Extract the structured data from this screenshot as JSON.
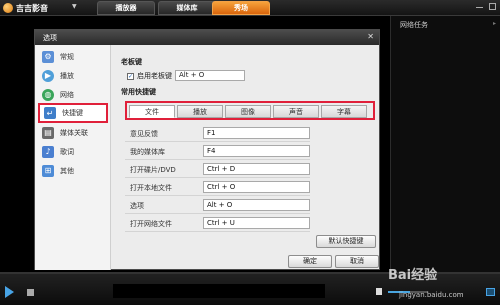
{
  "app": {
    "title": "吉吉影音",
    "tabs": [
      "播放器",
      "媒体库",
      "秀场"
    ],
    "side_panel_title": "网络任务"
  },
  "dialog": {
    "title": "选项",
    "nav": [
      "常规",
      "播放",
      "网络",
      "快捷键",
      "媒体关联",
      "歌词",
      "其他"
    ],
    "active_nav": "快捷键",
    "boss_key": {
      "section_title": "老板键",
      "checkbox_label": "启用老板键",
      "checked": true,
      "value": "Alt + O"
    },
    "shortcuts": {
      "section_title": "常用快捷键",
      "tabs": [
        "文件",
        "播放",
        "图像",
        "声音",
        "字幕"
      ],
      "active_tab": "文件",
      "rows": [
        {
          "label": "意见反馈",
          "key": "F1"
        },
        {
          "label": "我的媒体库",
          "key": "F4"
        },
        {
          "label": "打开碟片/DVD",
          "key": "Ctrl + D"
        },
        {
          "label": "打开本地文件",
          "key": "Ctrl + O"
        },
        {
          "label": "选项",
          "key": "Alt + O"
        },
        {
          "label": "打开网络文件",
          "key": "Ctrl + U"
        }
      ],
      "default_button": "默认快捷键"
    },
    "ok_button": "确定",
    "cancel_button": "取消"
  },
  "player": {
    "volume_level": 0.55,
    "progress": 0.0
  },
  "watermark": {
    "brand": "Bai经验",
    "url": "jingyan.baidu.com"
  },
  "colors": {
    "accent_orange": "#e8791a",
    "highlight_red": "#e0203a",
    "accent_blue": "#4aa6e0"
  }
}
